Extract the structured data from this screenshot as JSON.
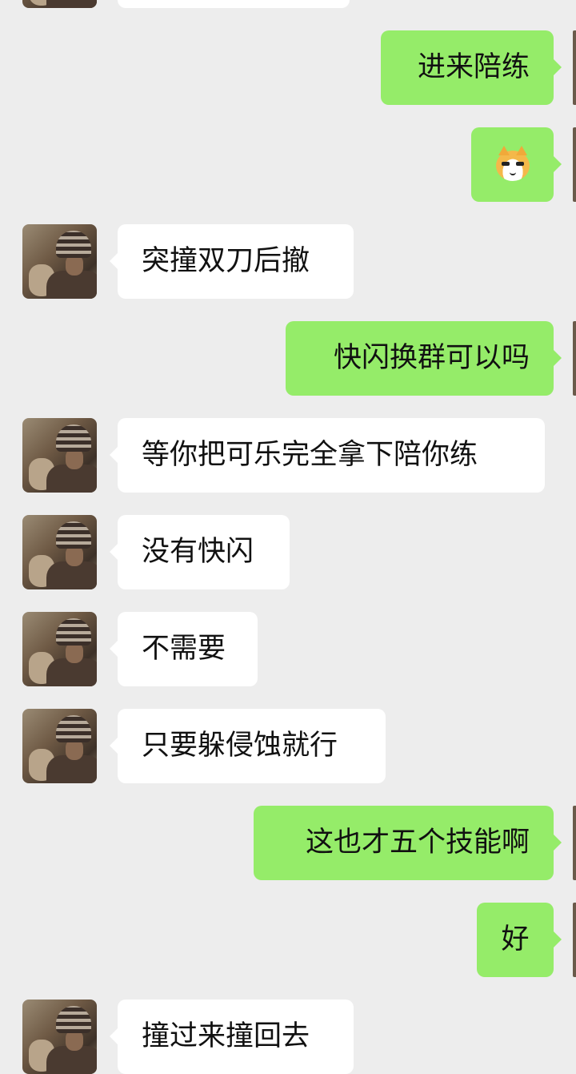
{
  "messages": [
    {
      "side": "in",
      "text": ""
    },
    {
      "side": "out",
      "text": "进来陪练"
    },
    {
      "side": "out",
      "sticker": "shiba-dog-face-emoji"
    },
    {
      "side": "in",
      "text": "突撞双刀后撤"
    },
    {
      "side": "out",
      "text": "快闪换群可以吗"
    },
    {
      "side": "in",
      "text": "等你把可乐完全拿下陪你练"
    },
    {
      "side": "in",
      "text": "没有快闪"
    },
    {
      "side": "in",
      "text": "不需要"
    },
    {
      "side": "in",
      "text": "只要躲侵蚀就行"
    },
    {
      "side": "out",
      "text": "这也才五个技能啊"
    },
    {
      "side": "out",
      "text": "好"
    },
    {
      "side": "in",
      "text": "撞过来撞回去"
    }
  ],
  "colors": {
    "background": "#ededed",
    "incoming_bubble": "#ffffff",
    "outgoing_bubble": "#95ec69",
    "text": "#111111"
  }
}
